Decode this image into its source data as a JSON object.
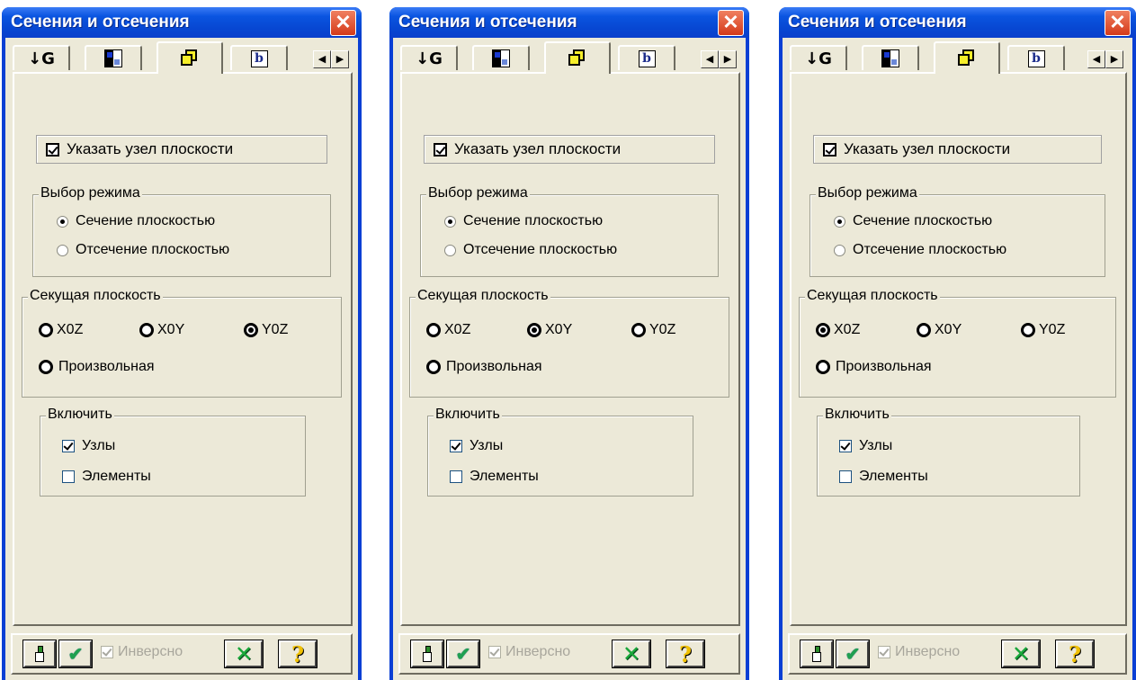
{
  "windows": [
    {
      "title": "Сечения и отсечения",
      "close_glyph": "✕",
      "tabs": [
        {
          "label": "↓G",
          "icon": "load-icon"
        },
        {
          "icon": "grid-icon"
        },
        {
          "icon": "cube-icon",
          "active": true
        },
        {
          "label": "b",
          "icon": "b-icon"
        }
      ],
      "tab_scroll": {
        "left": "◀",
        "right": "▶"
      },
      "pick_node": {
        "label": "Указать узел плоскости",
        "checked": true
      },
      "mode_group": {
        "legend": "Выбор режима",
        "options": [
          {
            "label": "Сечение плоскостью",
            "selected": true
          },
          {
            "label": "Отсечение плоскостью",
            "selected": false
          }
        ]
      },
      "plane_group": {
        "legend": "Секущая плоскость",
        "xoz": "X0Z",
        "xoy": "X0Y",
        "yoz": "Y0Z",
        "arbitrary": "Произвольная",
        "selected": "yoz"
      },
      "enable_group": {
        "legend": "Включить",
        "nodes": {
          "label": "Узлы",
          "checked": true
        },
        "elements": {
          "label": "Элементы",
          "checked": false
        }
      },
      "bottom": {
        "inverse": "Инверсно",
        "help": "?",
        "cancel": "✕",
        "apply": "✔"
      }
    },
    {
      "title": "Сечения и отсечения",
      "close_glyph": "✕",
      "tabs": [
        {
          "label": "↓G",
          "icon": "load-icon"
        },
        {
          "icon": "grid-icon"
        },
        {
          "icon": "cube-icon",
          "active": true
        },
        {
          "label": "b",
          "icon": "b-icon"
        }
      ],
      "tab_scroll": {
        "left": "◀",
        "right": "▶"
      },
      "pick_node": {
        "label": "Указать узел плоскости",
        "checked": true
      },
      "mode_group": {
        "legend": "Выбор режима",
        "options": [
          {
            "label": "Сечение плоскостью",
            "selected": true
          },
          {
            "label": "Отсечение плоскостью",
            "selected": false
          }
        ]
      },
      "plane_group": {
        "legend": "Секущая плоскость",
        "xoz": "X0Z",
        "xoy": "X0Y",
        "yoz": "Y0Z",
        "arbitrary": "Произвольная",
        "selected": "xoy"
      },
      "enable_group": {
        "legend": "Включить",
        "nodes": {
          "label": "Узлы",
          "checked": true
        },
        "elements": {
          "label": "Элементы",
          "checked": false
        }
      },
      "bottom": {
        "inverse": "Инверсно",
        "help": "?",
        "cancel": "✕",
        "apply": "✔"
      }
    },
    {
      "title": "Сечения и отсечения",
      "close_glyph": "✕",
      "tabs": [
        {
          "label": "↓G",
          "icon": "load-icon"
        },
        {
          "icon": "grid-icon"
        },
        {
          "icon": "cube-icon",
          "active": true
        },
        {
          "label": "b",
          "icon": "b-icon"
        }
      ],
      "tab_scroll": {
        "left": "◀",
        "right": "▶"
      },
      "pick_node": {
        "label": "Указать узел плоскости",
        "checked": true
      },
      "mode_group": {
        "legend": "Выбор режима",
        "options": [
          {
            "label": "Сечение плоскостью",
            "selected": true
          },
          {
            "label": "Отсечение плоскостью",
            "selected": false
          }
        ]
      },
      "plane_group": {
        "legend": "Секущая плоскость",
        "xoz": "X0Z",
        "xoy": "X0Y",
        "yoz": "Y0Z",
        "arbitrary": "Произвольная",
        "selected": "xoz"
      },
      "enable_group": {
        "legend": "Включить",
        "nodes": {
          "label": "Узлы",
          "checked": true
        },
        "elements": {
          "label": "Элементы",
          "checked": false
        }
      },
      "bottom": {
        "inverse": "Инверсно",
        "help": "?",
        "cancel": "✕",
        "apply": "✔"
      }
    }
  ]
}
